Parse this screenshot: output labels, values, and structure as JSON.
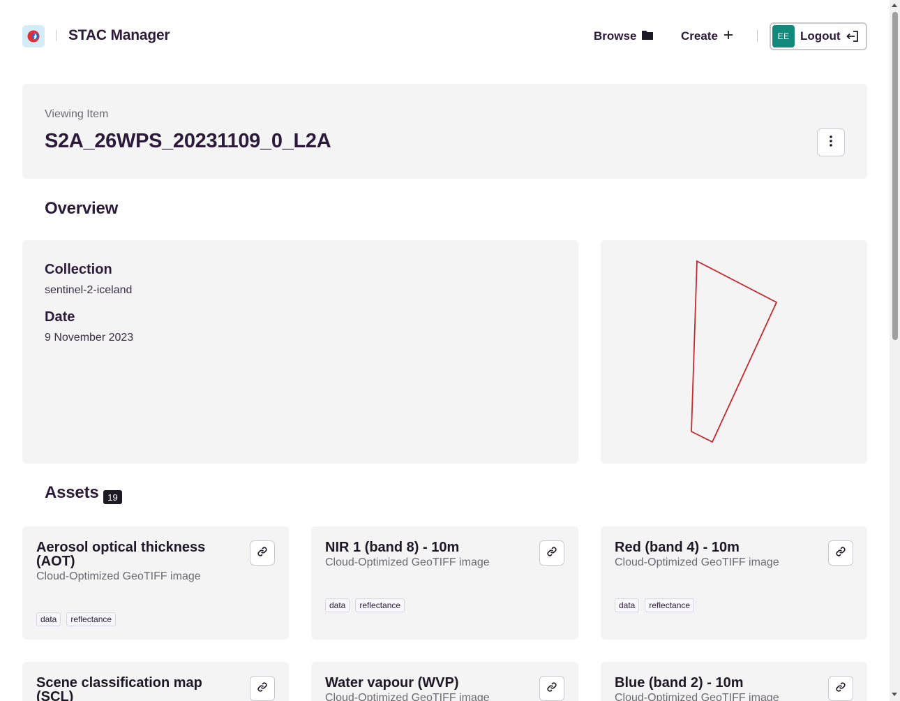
{
  "header": {
    "app_title": "STAC Manager",
    "nav": {
      "browse": "Browse",
      "create": "Create"
    },
    "user": {
      "initials": "EE",
      "logout": "Logout"
    }
  },
  "item": {
    "subtitle": "Viewing Item",
    "title": "S2A_26WPS_20231109_0_L2A"
  },
  "overview": {
    "heading": "Overview",
    "collection_label": "Collection",
    "collection_value": "sentinel-2-iceland",
    "date_label": "Date",
    "date_value": "9 November 2023"
  },
  "assets": {
    "heading": "Assets",
    "count": "19",
    "items": [
      {
        "title": "Aerosol optical thickness (AOT)",
        "type": "Cloud-Optimized GeoTIFF image",
        "tags": [
          "data",
          "reflectance"
        ]
      },
      {
        "title": "NIR 1 (band 8) - 10m",
        "type": "Cloud-Optimized GeoTIFF image",
        "tags": [
          "data",
          "reflectance"
        ]
      },
      {
        "title": "Red (band 4) - 10m",
        "type": "Cloud-Optimized GeoTIFF image",
        "tags": [
          "data",
          "reflectance"
        ]
      },
      {
        "title": "Scene classification map (SCL)",
        "type": "",
        "tags": []
      },
      {
        "title": "Water vapour (WVP)",
        "type": "Cloud-Optimized GeoTIFF image",
        "tags": []
      },
      {
        "title": "Blue (band 2) - 10m",
        "type": "Cloud-Optimized GeoTIFF image",
        "tags": []
      }
    ]
  },
  "colors": {
    "footprint": "#c5282f",
    "avatar": "#12897b",
    "card_bg": "#f4f4f4",
    "text_primary": "#2b1a3a"
  },
  "icons": [
    "logo-icon",
    "folder-icon",
    "plus-icon",
    "logout-icon",
    "kebab-icon",
    "link-icon"
  ]
}
